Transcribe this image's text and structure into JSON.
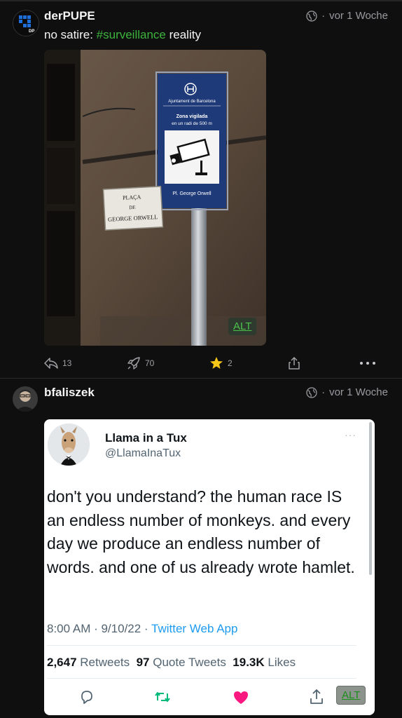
{
  "post1": {
    "username": "derPUPE",
    "time": "vor 1 Woche",
    "text_before": "no satire: ",
    "hashtag": "#surveillance",
    "text_after": " reality",
    "sign": {
      "city": "Ajuntament de Barcelona",
      "line1": "Zona vigilada",
      "line2": "en un radi de 500 m",
      "place": "Pl. George Orwell"
    },
    "street_sign": {
      "line1": "PLAÇA",
      "line2": "DE",
      "line3": "GEORGE ORWELL"
    },
    "alt_label": "ALT",
    "actions": {
      "reply_count": "13",
      "boost_count": "70",
      "fav_count": "2"
    }
  },
  "post2": {
    "username": "bfaliszek",
    "time": "vor 1 Woche",
    "tweet": {
      "name": "Llama in a Tux",
      "handle": "@LlamaInaTux",
      "dots": "···",
      "body": "don't you understand? the human race IS an endless number of monkeys. and every day we produce an endless number of words. and one of us already wrote hamlet.",
      "time": "8:00 AM · 9/10/22 · ",
      "app": "Twitter Web App",
      "retweets": "2,647",
      "retweets_label": " Retweets  ",
      "quotes": "97",
      "quotes_label": " Quote Tweets  ",
      "likes": "19.3K",
      "likes_label": " Likes"
    },
    "alt_label": "ALT"
  },
  "colors": {
    "hashtag": "#3cb43c",
    "star": "#f5c518",
    "heart": "#f91880",
    "retweet": "#00ba7c",
    "link_blue": "#1d9bf0"
  }
}
